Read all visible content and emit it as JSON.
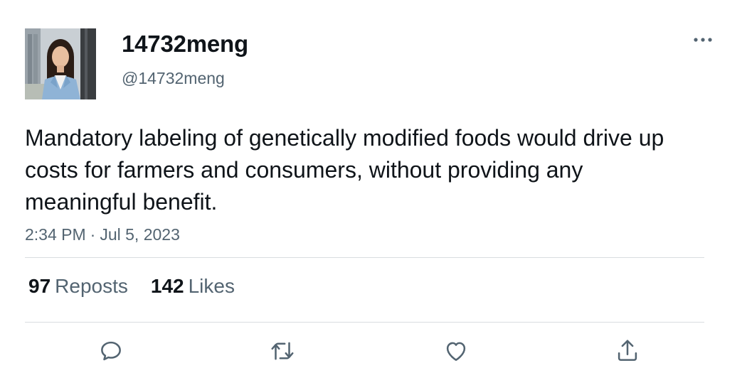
{
  "author": {
    "display_name": "14732meng",
    "handle": "@14732meng",
    "avatar_icon": "profile-photo"
  },
  "menu": {
    "icon": "more-horizontal-icon"
  },
  "tweet": {
    "text": "Mandatory labeling of genetically modified foods would drive up costs for farmers and consumers, without providing any meaningful benefit.",
    "time": "2:34 PM",
    "separator": "·",
    "date": "Jul 5, 2023"
  },
  "stats": {
    "reposts_count": "97",
    "reposts_label": "Reposts",
    "likes_count": "142",
    "likes_label": "Likes"
  },
  "actions": [
    {
      "name": "reply",
      "icon": "reply-icon"
    },
    {
      "name": "repost",
      "icon": "repost-icon"
    },
    {
      "name": "like",
      "icon": "heart-icon"
    },
    {
      "name": "share",
      "icon": "share-icon"
    }
  ],
  "colors": {
    "text_primary": "#0f1419",
    "text_secondary": "#536471",
    "divider": "#d9dde0"
  }
}
